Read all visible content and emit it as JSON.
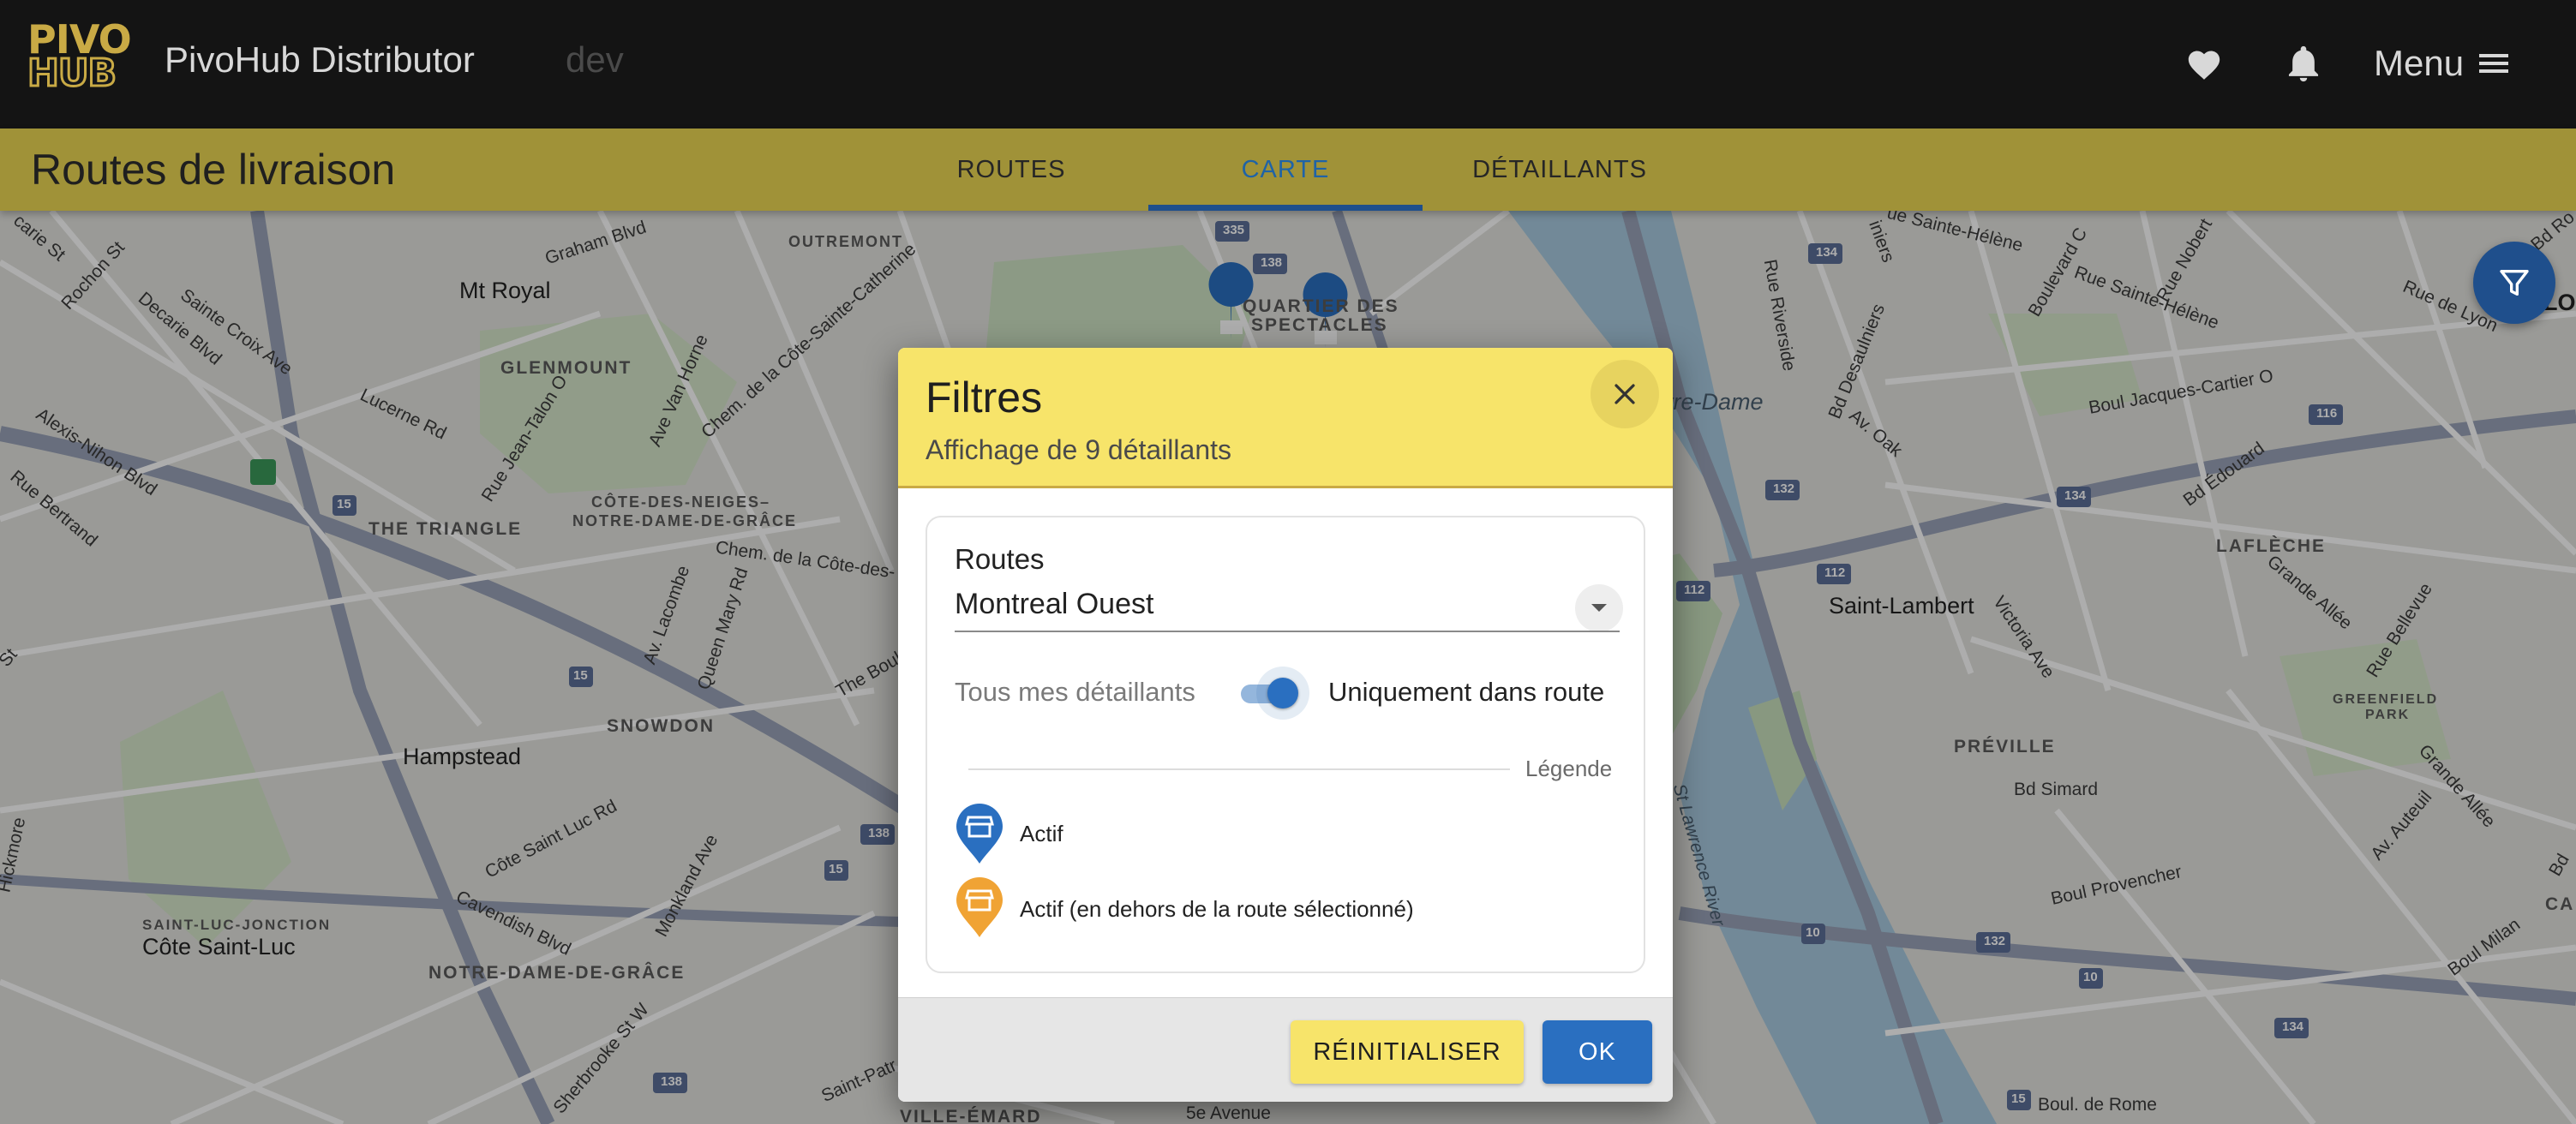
{
  "appbar": {
    "logo_top": "PIVO",
    "logo_bottom": "HUB",
    "title": "PivoHub Distributor",
    "environment": "dev",
    "favorites_icon": "heart-icon",
    "notifications_icon": "bell-icon",
    "menu_label": "Menu",
    "menu_icon": "hamburger-icon"
  },
  "page": {
    "title": "Routes de livraison",
    "tabs": [
      {
        "label": "ROUTES",
        "active": false
      },
      {
        "label": "CARTE",
        "active": true
      },
      {
        "label": "DÉTAILLANTS",
        "active": false
      }
    ]
  },
  "map": {
    "filter_icon": "filter-icon",
    "labels": {
      "mt_royal": "Mt Royal",
      "glenmount": "GLENMOUNT",
      "the_triangle": "THE TRIANGLE",
      "cote_des_neiges_1": "CÔTE-DES-NEIGES–",
      "cote_des_neiges_2": "NOTRE-DAME-DE-GRÂCE",
      "snowdon": "SNOWDON",
      "hampstead": "Hampstead",
      "saint_luc_jonction": "SAINT-LUC-JONCTION",
      "cote_saint_luc": "Côte Saint-Luc",
      "notre_dame_de_grace": "NOTRE-DAME-DE-GRÂCE",
      "outremont": "OUTREMONT",
      "quartier_1": "QUARTIER DES",
      "quartier_2": "SPECTACLES",
      "saint_lambert": "Saint-Lambert",
      "lafleche": "LAFLÈCHE",
      "preville": "PRÉVILLE",
      "greenfield_1": "GREENFIELD",
      "greenfield_2": "PARK",
      "ville_emard": "VILLE-ÉMARD",
      "notre_dame_partial": "otre-Dame",
      "graham_blvd": "Graham Blvd",
      "decarie_blvd": "Decarie Blvd",
      "rochon_st": "Rochon St",
      "sainte_croix": "Sainte Croix Ave",
      "lucerne": "Lucerne Rd",
      "alexis_nihon": "Alexis-Nihon Blvd",
      "rue_bertrand": "Rue Bertrand",
      "jean_talon": "Rue Jean-Talon O",
      "van_horne": "Ave Van Horne",
      "chem_cote_ste_catherine": "Chem. de la Côte-Sainte-Catherine",
      "chem_cote_des": "Chem. de la Côte-des-",
      "av_lacombe": "Av. Lacombe",
      "queen_mary": "Queen Mary Rd",
      "cote_saint_luc_rd": "Côte Saint Luc Rd",
      "cavendish": "Cavendish Blvd",
      "monkland": "Monkland Ave",
      "sherbrooke": "Sherbrooke St W",
      "saint_patrick": "Saint-Patr",
      "cinquieme_avenue": "5e Avenue",
      "the_boul": "The Boul",
      "rue_riverside": "Rue Riverside",
      "bd_desaulniers": "Bd Desaulniers",
      "av_oak": "Av. Oak",
      "boul_jacques_cartier": "Boul Jacques-Cartier O",
      "rue_sainte_helene_1": "Rue Sainte-Hélène",
      "rue_sainte_helene_2": "Rue Sainte-Hélène",
      "boulevard_c": "Boulevard C",
      "rue_nobert": "Rue Nobert",
      "rue_de_lyon": "Rue de Lyon",
      "bd_edouard": "Bd Édouard",
      "grande_allee_1": "Grande Allée",
      "grande_allee_2": "Grande Allée",
      "victoria_ave": "Victoria Ave",
      "rue_bellevue": "Rue Bellevue",
      "bd_simard": "Bd Simard",
      "av_auteuil": "Av. Auteuil",
      "boul_provencher": "Boul Provencher",
      "boul_milan": "Boul Milan",
      "boul_de_rome": "Boul. de Rome",
      "st_lawrence": "St Lawrence River",
      "rue_sainte_partial": "ue Sainte-Hélène",
      "iniers_partial": "iniers",
      "bd_ro_partial": "Bd Ro",
      "lo_partial": "LO",
      "ca_partial": "CA",
      "bd_partial": "Bd",
      "hickmore_partial": "Hickmore",
      "st_partial": "St",
      "ecarie_partial": "carie St",
      "route_15a": "15",
      "route_15b": "15",
      "route_15c": "15",
      "route_138a": "138",
      "route_138b": "138",
      "route_138c": "138",
      "route_335": "335",
      "route_134a": "134",
      "route_134b": "134",
      "route_134c": "134",
      "route_132a": "132",
      "route_132b": "132",
      "route_112a": "112",
      "route_112b": "112",
      "route_116": "116",
      "route_10a": "10",
      "route_10b": "10",
      "route_15d": "15"
    }
  },
  "dialog": {
    "title": "Filtres",
    "subtitle": "Affichage de 9 détaillants",
    "close_icon": "close-icon",
    "routes_label": "Routes",
    "routes_value": "Montreal Ouest",
    "toggle_off_label": "Tous mes détaillants",
    "toggle_on_label": "Uniquement dans route",
    "toggle_checked": true,
    "legend_title": "Légende",
    "legend": [
      {
        "label": "Actif",
        "color": "#2a6fc0",
        "icon": "store-pin-blue-icon"
      },
      {
        "label": "Actif (en dehors de la route sélectionné)",
        "color": "#f0a334",
        "icon": "store-pin-orange-icon"
      }
    ],
    "reset_label": "RÉINITIALISER",
    "ok_label": "OK"
  },
  "colors": {
    "appbar_bg": "#141414",
    "brand_gold": "#c9aa45",
    "pagebar_bg": "#a09238",
    "dialog_header": "#f7e46a",
    "primary_blue": "#2a6fc0",
    "tab_indicator": "#1f4f8c"
  }
}
